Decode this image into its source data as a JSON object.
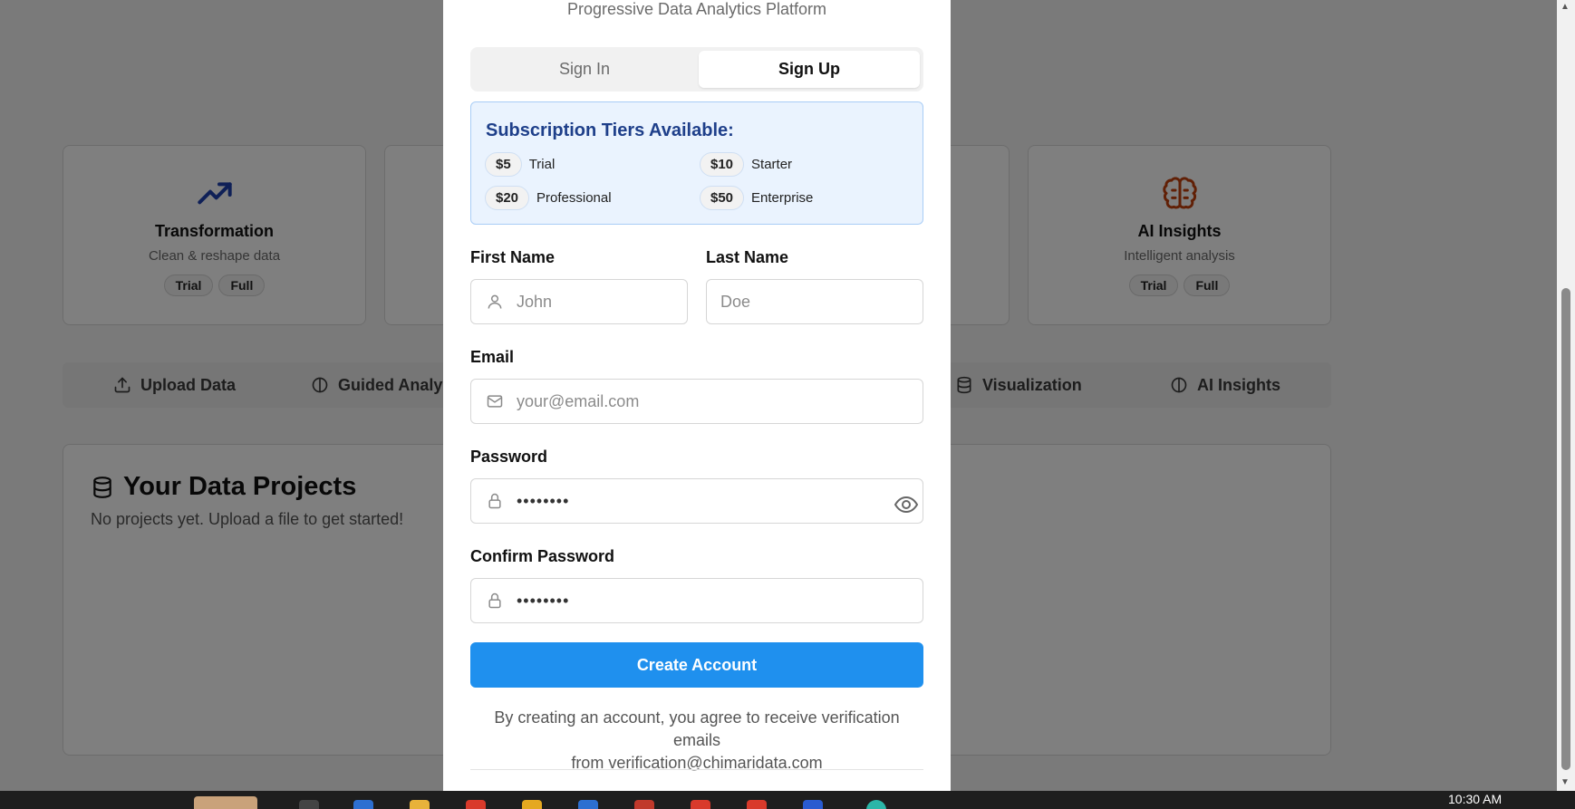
{
  "background": {
    "feature_cards": [
      {
        "title": "Transformation",
        "subtitle": "Clean & reshape data",
        "badges": [
          "Trial",
          "Full"
        ],
        "icon": "trending-up-icon",
        "color": "#1e40af"
      },
      {
        "title": "AI Insights",
        "subtitle": "Intelligent analysis",
        "badges": [
          "Trial",
          "Full"
        ],
        "icon": "brain-icon",
        "color": "#c2410c"
      }
    ],
    "nav_tabs": [
      {
        "label": "Upload Data",
        "icon": "upload-icon"
      },
      {
        "label": "Guided Analysis",
        "icon": "brain-icon"
      },
      {
        "label": "Visualization",
        "icon": "database-icon"
      },
      {
        "label": "AI Insights",
        "icon": "brain-icon"
      }
    ],
    "projects": {
      "title": "Your Data Projects",
      "empty_text": "No projects yet. Upload a file to get started!"
    }
  },
  "modal": {
    "subtitle": "Progressive Data Analytics Platform",
    "tabs": {
      "sign_in": "Sign In",
      "sign_up": "Sign Up",
      "active": "sign_up"
    },
    "tiers": {
      "heading": "Subscription Tiers Available:",
      "items": [
        {
          "price": "$5",
          "name": "Trial"
        },
        {
          "price": "$10",
          "name": "Starter"
        },
        {
          "price": "$20",
          "name": "Professional"
        },
        {
          "price": "$50",
          "name": "Enterprise"
        }
      ]
    },
    "form": {
      "first_name": {
        "label": "First Name",
        "placeholder": "John"
      },
      "last_name": {
        "label": "Last Name",
        "placeholder": "Doe"
      },
      "email": {
        "label": "Email",
        "placeholder": "your@email.com"
      },
      "password": {
        "label": "Password",
        "value": "••••••••"
      },
      "confirm_password": {
        "label": "Confirm Password",
        "value": "••••••••"
      }
    },
    "submit_label": "Create Account",
    "terms_line1": "By creating an account, you agree to receive verification emails",
    "terms_line2": "from verification@chimaridata.com"
  },
  "colors": {
    "primary": "#1f90ee",
    "tier_heading": "#1e3f8a",
    "tier_bg": "#eaf3fe"
  },
  "taskbar": {
    "clock": "10:30 AM"
  }
}
